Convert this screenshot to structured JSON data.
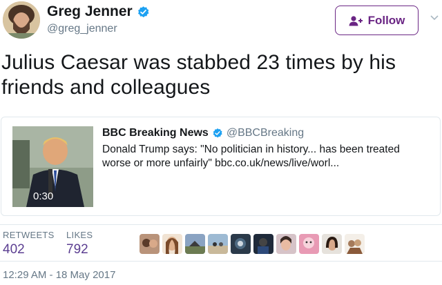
{
  "tweet": {
    "author_name": "Greg Jenner",
    "author_handle": "@greg_jenner",
    "follow_label": "Follow",
    "text": "Julius Caesar was stabbed 23 times by his friends and colleagues",
    "timestamp": "12:29 AM - 18 May 2017"
  },
  "quoted": {
    "author_name": "BBC Breaking News",
    "author_handle": "@BBCBreaking",
    "text": "Donald Trump says:  \"No politician in history... has been treated worse or more unfairly\" bbc.co.uk/news/live/worl...",
    "video_duration": "0:30"
  },
  "stats": {
    "retweets_label": "RETWEETS",
    "retweets_value": "402",
    "likes_label": "LIKES",
    "likes_value": "792"
  },
  "colors": {
    "follow_accent": "#6a2584",
    "verified_blue": "#1da1f2",
    "count_purple": "#5b3e91",
    "secondary_text": "#657786"
  },
  "icons": {
    "verified": "verified-badge-icon",
    "follow": "add-user-icon",
    "menu": "chevron-down-icon"
  }
}
